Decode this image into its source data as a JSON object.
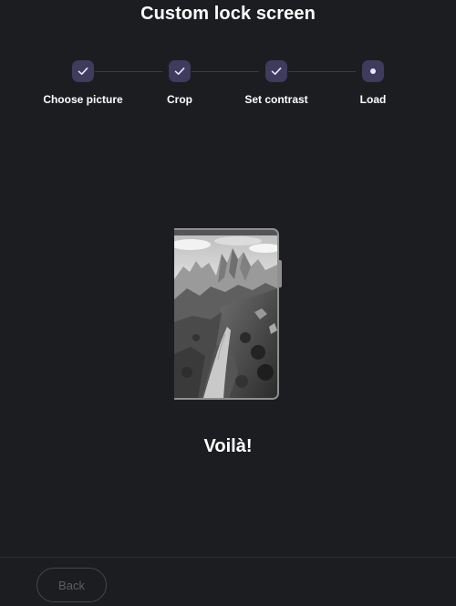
{
  "header": {
    "title": "Custom lock screen"
  },
  "stepper": {
    "steps": [
      {
        "label": "Choose picture",
        "state": "completed",
        "icon": "check-icon"
      },
      {
        "label": "Crop",
        "state": "completed",
        "icon": "check-icon"
      },
      {
        "label": "Set contrast",
        "state": "completed",
        "icon": "check-icon"
      },
      {
        "label": "Load",
        "state": "current",
        "icon": "dot-icon"
      }
    ],
    "colors": {
      "step_fill": "#3e3b5c",
      "step_mark": "#e9e6ff",
      "connector": "#3b3c42"
    }
  },
  "preview": {
    "image_subject": "mountain-landscape-grayscale"
  },
  "result": {
    "message": "Voilà!"
  },
  "footer": {
    "back_label": "Back"
  },
  "colors": {
    "background": "#1c1d20",
    "text": "#ffffff",
    "disabled_text": "#5d5e63"
  }
}
